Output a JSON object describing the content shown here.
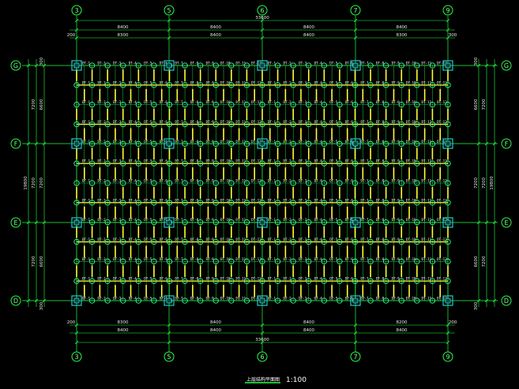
{
  "drawing": {
    "title": "上层结构平面图",
    "scale": "1:100",
    "colors": {
      "background": "#000000",
      "grid": "#22ff44",
      "beam": "#ffff33",
      "column": "#22cccc",
      "node": "#33ff99",
      "text": "#ffffff"
    }
  },
  "axes": {
    "columns": [
      "3",
      "5",
      "6",
      "7",
      "9"
    ],
    "rows": [
      "G",
      "F",
      "E",
      "D"
    ]
  },
  "dimensions": {
    "top": {
      "total": "33600",
      "spans": [
        "8400",
        "8400",
        "8400",
        "8400"
      ],
      "inner_spans": [
        "8300",
        "8400",
        "8400",
        "8300"
      ],
      "edge_left": "200",
      "edge_right": "300"
    },
    "bottom": {
      "total": "33600",
      "spans": [
        "8400",
        "8400",
        "8400",
        "8400"
      ],
      "inner_spans": [
        "8300",
        "8400",
        "8400",
        "8200"
      ],
      "edge_left": "200",
      "edge_right": "200"
    },
    "left": {
      "total": "19800",
      "outer": [
        "7200",
        "7200",
        "7200"
      ],
      "inner": [
        "6600",
        "7200",
        "6600"
      ],
      "edge_top": "300",
      "edge_bottom": "300"
    },
    "right": {
      "total": "19800",
      "outer": [
        "7200",
        "7200",
        "7200"
      ],
      "inner": [
        "6600",
        "7200",
        "6600"
      ],
      "edge_top": "300",
      "edge_bottom": "300"
    }
  },
  "members": {
    "beam_prefix": "DT",
    "codes": [
      "DT-1",
      "DT-2",
      "DT-3",
      "DT-4",
      "DT-5",
      "DT-6",
      "DT-7",
      "DT-8",
      "DT-9",
      "DT-10",
      "DT-11",
      "DT-12"
    ]
  }
}
